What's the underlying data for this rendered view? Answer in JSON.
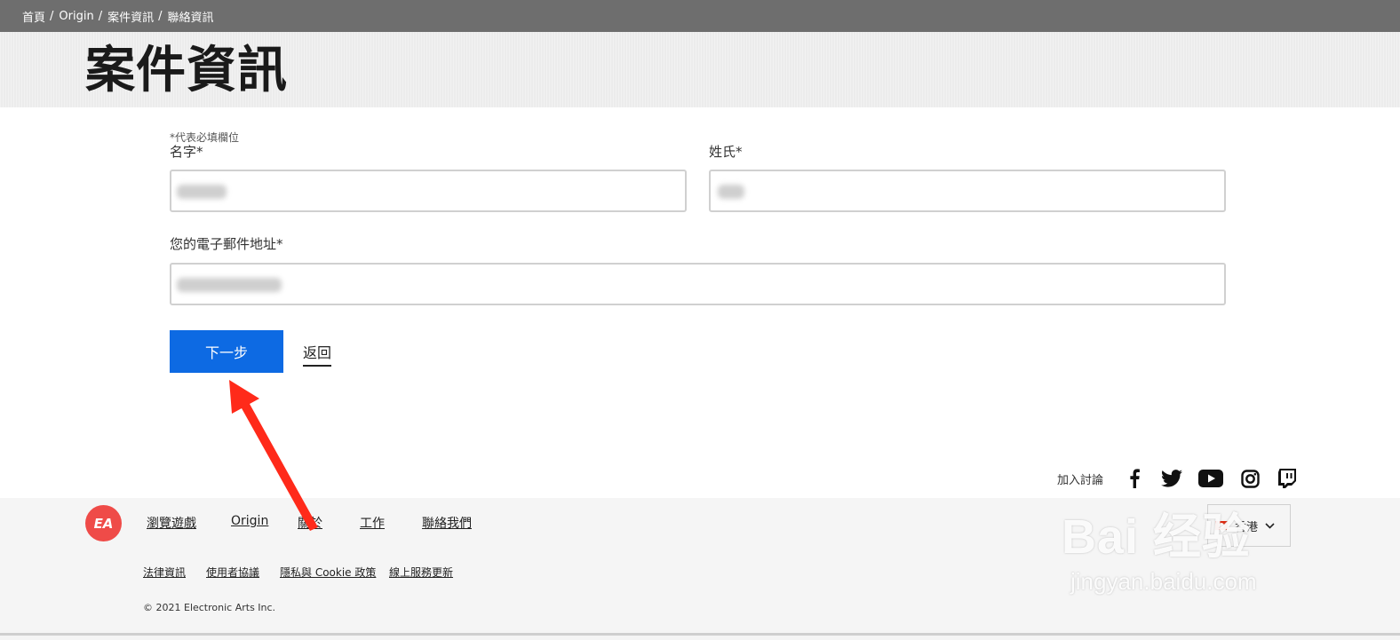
{
  "breadcrumb": [
    "首頁",
    "Origin",
    "案件資訊",
    "聯絡資訊"
  ],
  "breadcrumb_separator": "/",
  "page_title": "案件資訊",
  "form": {
    "required_note": "*代表必填欄位",
    "first_name_label": "名字*",
    "last_name_label": "姓氏*",
    "email_label": "您的電子郵件地址*",
    "next_button": "下一步",
    "back_link": "返回"
  },
  "social": {
    "join_label": "加入討論",
    "icons": [
      "facebook-icon",
      "twitter-icon",
      "youtube-icon",
      "instagram-icon",
      "twitch-icon"
    ]
  },
  "footer": {
    "logo": "EA",
    "nav": [
      "瀏覽遊戲",
      "Origin",
      "關於",
      "工作",
      "聯絡我們"
    ],
    "language": "香港",
    "legal": [
      "法律資訊",
      "使用者協議",
      "隱私與 Cookie 政策",
      "線上服務更新"
    ],
    "copyright": "© 2021 Electronic Arts Inc."
  },
  "watermark": {
    "brand": "Bai 经验",
    "url": "jingyan.baidu.com"
  },
  "colors": {
    "breadcrumb_bg": "#6e6e6e",
    "primary_button": "#0d6ae3",
    "ea_logo": "#ef4b48",
    "annotation_arrow": "#ff2a1a"
  }
}
